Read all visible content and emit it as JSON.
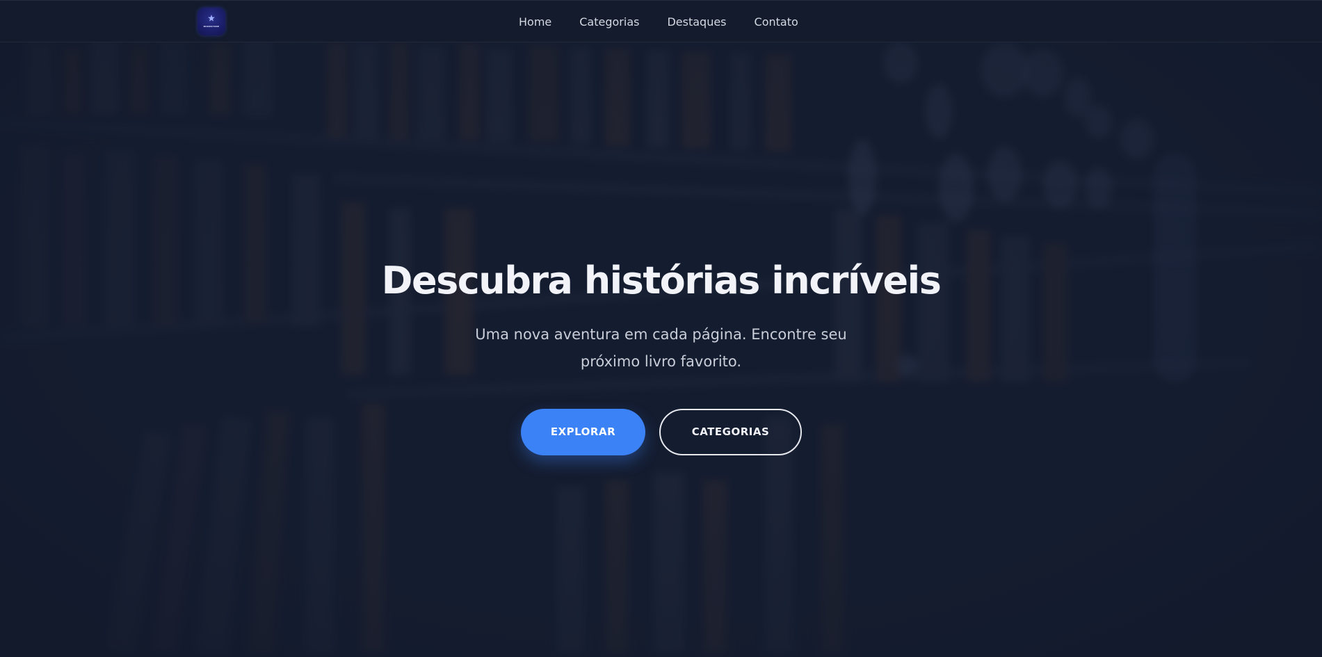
{
  "colors": {
    "background": "#141c2f",
    "navbar": "#131b2d",
    "accent": "#3b82f6",
    "title": "#f1f3f8",
    "subtitle": "#c9cdd8",
    "nav_text": "#d4d8e2"
  },
  "header": {
    "logo_icon": "bookstore-logo-icon",
    "logo_text": "BOOKSTORE",
    "nav": [
      {
        "label": "Home"
      },
      {
        "label": "Categorias"
      },
      {
        "label": "Destaques"
      },
      {
        "label": "Contato"
      }
    ]
  },
  "hero": {
    "background": "blurred-bookshelf-image",
    "title": "Descubra histórias incríveis",
    "subtitle": "Uma nova aventura em cada página. Encontre seu próximo livro favorito.",
    "primary_button": "EXPLORAR",
    "secondary_button": "CATEGORIAS"
  }
}
